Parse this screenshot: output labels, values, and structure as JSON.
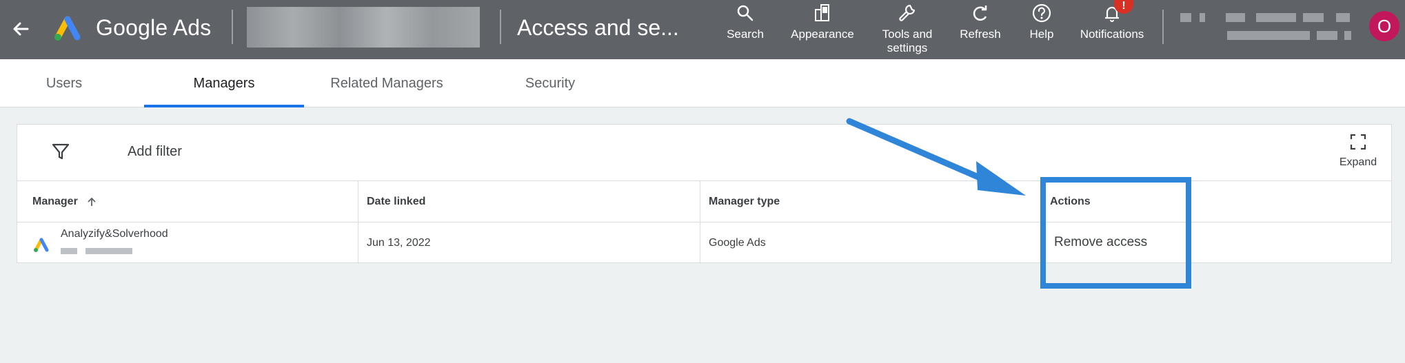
{
  "header": {
    "brand": "Google Ads",
    "page_title": "Access and se...",
    "tools": [
      {
        "label": "Search",
        "icon": "search-icon"
      },
      {
        "label": "Appearance",
        "icon": "appearance-icon"
      },
      {
        "label": "Tools and\nsettings",
        "icon": "wrench-icon"
      },
      {
        "label": "Refresh",
        "icon": "refresh-icon"
      },
      {
        "label": "Help",
        "icon": "help-icon"
      },
      {
        "label": "Notifications",
        "icon": "bell-icon"
      }
    ],
    "notification_badge": "!",
    "avatar_initial": "O",
    "colors": {
      "bar": "#5f6368",
      "avatar": "#c2185b",
      "badge": "#d93025"
    }
  },
  "tabs": [
    {
      "label": "Users",
      "active": false
    },
    {
      "label": "Managers",
      "active": true
    },
    {
      "label": "Related Managers",
      "active": false
    },
    {
      "label": "Security",
      "active": false
    }
  ],
  "toolbar": {
    "add_filter": "Add filter",
    "expand": "Expand"
  },
  "table": {
    "columns": [
      "Manager",
      "Date linked",
      "Manager type",
      "Actions"
    ],
    "sort_column": "Manager",
    "rows": [
      {
        "manager": "Analyzify&Solverhood",
        "date_linked": "Jun 13, 2022",
        "manager_type": "Google Ads",
        "action": "Remove access"
      }
    ]
  },
  "annotation_color": "#2f86d8"
}
